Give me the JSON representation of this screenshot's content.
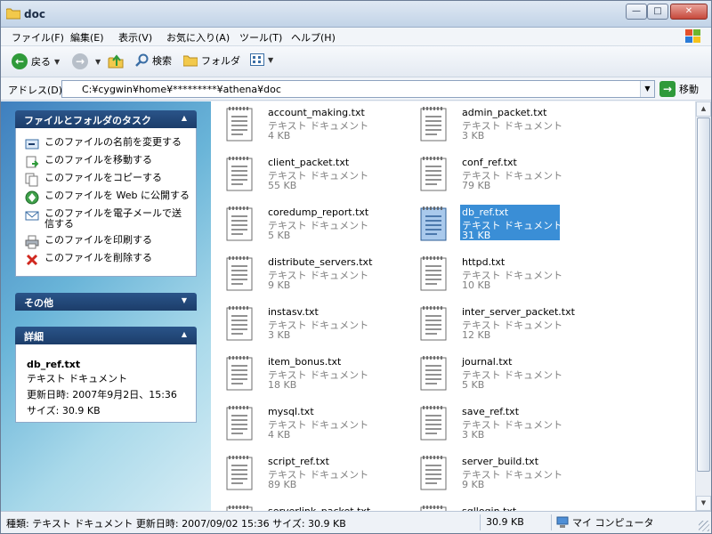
{
  "window": {
    "title": "doc"
  },
  "menu": [
    "ファイル(F)",
    "編集(E)",
    "表示(V)",
    "お気に入り(A)",
    "ツール(T)",
    "ヘルプ(H)"
  ],
  "toolbar": {
    "back_label": "戻る",
    "search_label": "検索",
    "folders_label": "フォルダ"
  },
  "address": {
    "label": "アドレス(D)",
    "path": "C:¥cygwin¥home¥*********¥athena¥doc",
    "go_label": "移動"
  },
  "tasks": {
    "header": "ファイルとフォルダのタスク",
    "items": [
      "このファイルの名前を変更する",
      "このファイルを移動する",
      "このファイルをコピーする",
      "このファイルを Web に公開する",
      "このファイルを電子メールで送信する",
      "このファイルを印刷する",
      "このファイルを削除する"
    ]
  },
  "other": {
    "header": "その他"
  },
  "details": {
    "header": "詳細",
    "name": "db_ref.txt",
    "type": "テキスト ドキュメント",
    "modified": "更新日時: 2007年9月2日、15:36",
    "size": "サイズ: 30.9 KB"
  },
  "files": [
    {
      "name": "account_making.txt",
      "type": "テキスト ドキュメント",
      "size": "4 KB"
    },
    {
      "name": "admin_packet.txt",
      "type": "テキスト ドキュメント",
      "size": "3 KB"
    },
    {
      "name": "client_packet.txt",
      "type": "テキスト ドキュメント",
      "size": "55 KB"
    },
    {
      "name": "conf_ref.txt",
      "type": "テキスト ドキュメント",
      "size": "79 KB"
    },
    {
      "name": "coredump_report.txt",
      "type": "テキスト ドキュメント",
      "size": "5 KB"
    },
    {
      "name": "db_ref.txt",
      "type": "テキスト ドキュメント",
      "size": "31 KB",
      "selected": true
    },
    {
      "name": "distribute_servers.txt",
      "type": "テキスト ドキュメント",
      "size": "9 KB"
    },
    {
      "name": "httpd.txt",
      "type": "テキスト ドキュメント",
      "size": "10 KB"
    },
    {
      "name": "instasv.txt",
      "type": "テキスト ドキュメント",
      "size": "3 KB"
    },
    {
      "name": "inter_server_packet.txt",
      "type": "テキスト ドキュメント",
      "size": "12 KB"
    },
    {
      "name": "item_bonus.txt",
      "type": "テキスト ドキュメント",
      "size": "18 KB"
    },
    {
      "name": "journal.txt",
      "type": "テキスト ドキュメント",
      "size": "5 KB"
    },
    {
      "name": "mysql.txt",
      "type": "テキスト ドキュメント",
      "size": "4 KB"
    },
    {
      "name": "save_ref.txt",
      "type": "テキスト ドキュメント",
      "size": "3 KB"
    },
    {
      "name": "script_ref.txt",
      "type": "テキスト ドキュメント",
      "size": "89 KB"
    },
    {
      "name": "server_build.txt",
      "type": "テキスト ドキュメント",
      "size": "9 KB"
    },
    {
      "name": "serverlink_packet.txt",
      "type": "",
      "size": ""
    },
    {
      "name": "sqllogin.txt",
      "type": "",
      "size": ""
    }
  ],
  "status": {
    "info": "種類: テキスト ドキュメント 更新日時: 2007/09/02 15:36 サイズ: 30.9 KB",
    "size": "30.9 KB",
    "location": "マイ コンピュータ"
  }
}
